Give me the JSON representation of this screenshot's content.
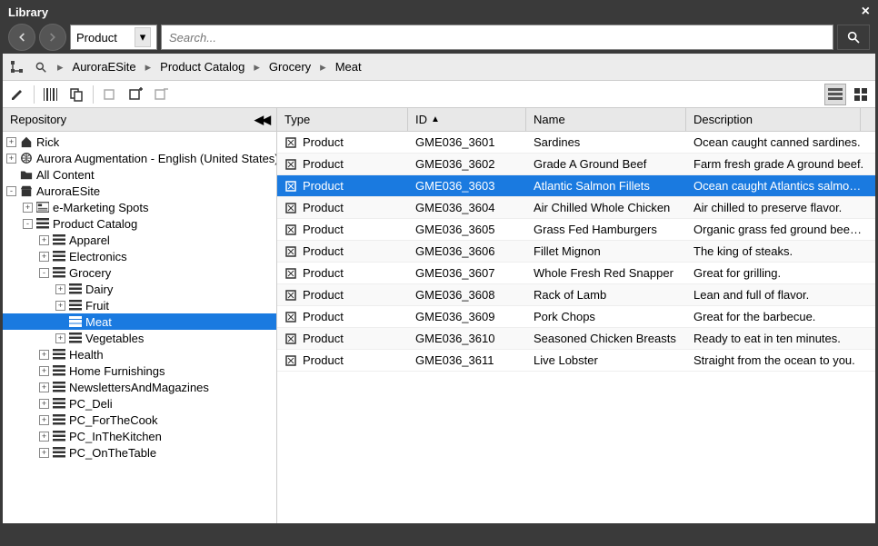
{
  "window": {
    "title": "Library",
    "close": "×"
  },
  "nav": {
    "type_filter": "Product",
    "search_placeholder": "Search..."
  },
  "breadcrumb": [
    "AuroraESite",
    "Product Catalog",
    "Grocery",
    "Meat"
  ],
  "tree": {
    "header": "Repository",
    "nodes": [
      {
        "label": "Rick",
        "depth": 0,
        "toggle": "+",
        "icon": "home"
      },
      {
        "label": "Aurora Augmentation - English (United States)",
        "depth": 0,
        "toggle": "+",
        "icon": "globe"
      },
      {
        "label": "All Content",
        "depth": 0,
        "toggle": "",
        "icon": "folder"
      },
      {
        "label": "AuroraESite",
        "depth": 0,
        "toggle": "-",
        "icon": "store"
      },
      {
        "label": "e-Marketing Spots",
        "depth": 1,
        "toggle": "+",
        "icon": "emspot"
      },
      {
        "label": "Product Catalog",
        "depth": 1,
        "toggle": "-",
        "icon": "list"
      },
      {
        "label": "Apparel",
        "depth": 2,
        "toggle": "+",
        "icon": "list"
      },
      {
        "label": "Electronics",
        "depth": 2,
        "toggle": "+",
        "icon": "list"
      },
      {
        "label": "Grocery",
        "depth": 2,
        "toggle": "-",
        "icon": "list"
      },
      {
        "label": "Dairy",
        "depth": 3,
        "toggle": "+",
        "icon": "list"
      },
      {
        "label": "Fruit",
        "depth": 3,
        "toggle": "+",
        "icon": "list"
      },
      {
        "label": "Meat",
        "depth": 3,
        "toggle": "",
        "icon": "list",
        "selected": true
      },
      {
        "label": "Vegetables",
        "depth": 3,
        "toggle": "+",
        "icon": "list"
      },
      {
        "label": "Health",
        "depth": 2,
        "toggle": "+",
        "icon": "list"
      },
      {
        "label": "Home Furnishings",
        "depth": 2,
        "toggle": "+",
        "icon": "list"
      },
      {
        "label": "NewslettersAndMagazines",
        "depth": 2,
        "toggle": "+",
        "icon": "list"
      },
      {
        "label": "PC_Deli",
        "depth": 2,
        "toggle": "+",
        "icon": "list"
      },
      {
        "label": "PC_ForTheCook",
        "depth": 2,
        "toggle": "+",
        "icon": "list"
      },
      {
        "label": "PC_InTheKitchen",
        "depth": 2,
        "toggle": "+",
        "icon": "list"
      },
      {
        "label": "PC_OnTheTable",
        "depth": 2,
        "toggle": "+",
        "icon": "list"
      }
    ]
  },
  "grid": {
    "columns": {
      "type": "Type",
      "id": "ID",
      "name": "Name",
      "desc": "Description"
    },
    "sort_indicator": "▲",
    "rows": [
      {
        "type": "Product",
        "id": "GME036_3601",
        "name": "Sardines",
        "desc": "Ocean caught canned sardines."
      },
      {
        "type": "Product",
        "id": "GME036_3602",
        "name": "Grade A Ground Beef",
        "desc": "Farm fresh grade A ground beef."
      },
      {
        "type": "Product",
        "id": "GME036_3603",
        "name": "Atlantic Salmon Fillets",
        "desc": "Ocean caught Atlantics salmon ...",
        "selected": true
      },
      {
        "type": "Product",
        "id": "GME036_3604",
        "name": "Air Chilled Whole Chicken",
        "desc": "Air chilled to preserve flavor."
      },
      {
        "type": "Product",
        "id": "GME036_3605",
        "name": "Grass Fed Hamburgers",
        "desc": "Organic grass fed ground beef p..."
      },
      {
        "type": "Product",
        "id": "GME036_3606",
        "name": "Fillet Mignon",
        "desc": "The king of steaks."
      },
      {
        "type": "Product",
        "id": "GME036_3607",
        "name": "Whole Fresh Red Snapper",
        "desc": "Great for grilling."
      },
      {
        "type": "Product",
        "id": "GME036_3608",
        "name": "Rack of Lamb",
        "desc": "Lean and full of flavor."
      },
      {
        "type": "Product",
        "id": "GME036_3609",
        "name": "Pork Chops",
        "desc": "Great for the barbecue."
      },
      {
        "type": "Product",
        "id": "GME036_3610",
        "name": "Seasoned Chicken Breasts",
        "desc": "Ready to eat in ten minutes."
      },
      {
        "type": "Product",
        "id": "GME036_3611",
        "name": "Live Lobster",
        "desc": "Straight from the ocean to you."
      }
    ]
  }
}
